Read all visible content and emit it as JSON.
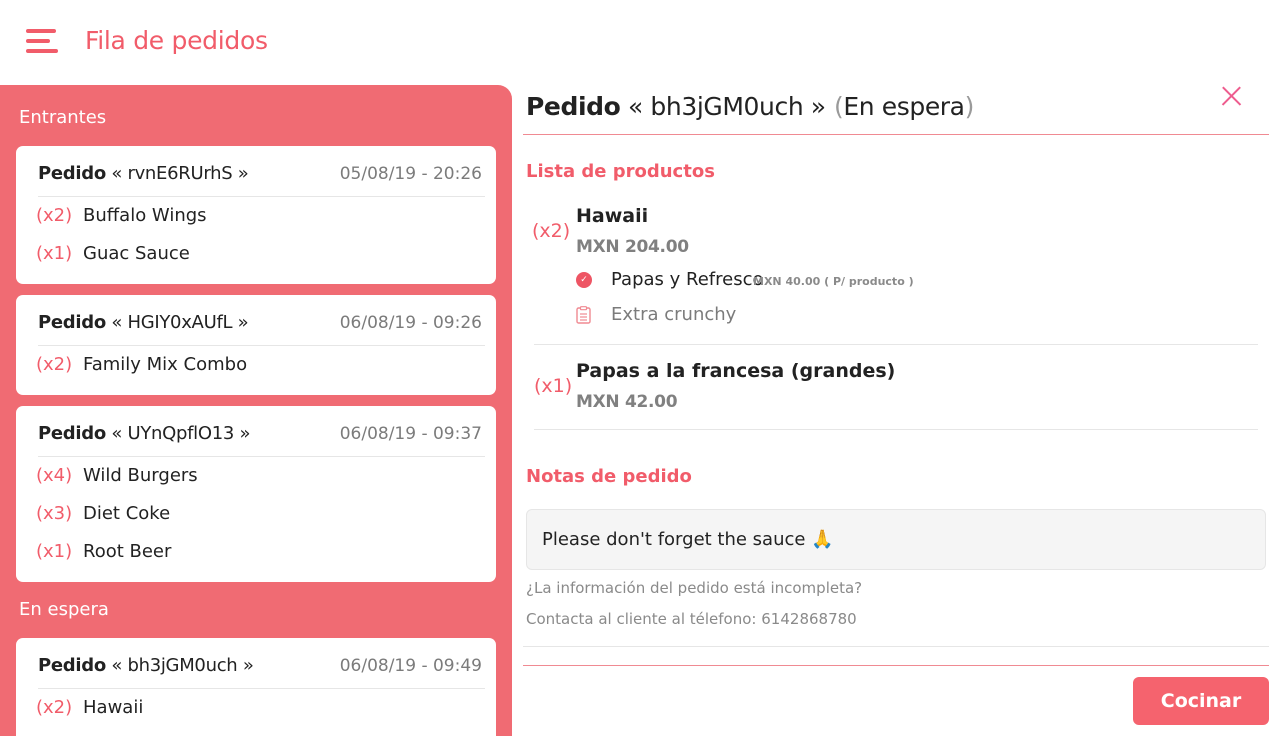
{
  "header": {
    "title": "Fila de pedidos"
  },
  "sections": {
    "incoming": "Entrantes",
    "waiting": "En espera"
  },
  "orders": [
    {
      "label": "Pedido",
      "code": "« rvnE6RUrhS »",
      "date": "05/08/19 - 20:26",
      "items": [
        {
          "qty": "(x2)",
          "name": "Buffalo Wings"
        },
        {
          "qty": "(x1)",
          "name": "Guac Sauce"
        }
      ]
    },
    {
      "label": "Pedido",
      "code": "« HGIY0xAUfL »",
      "date": "06/08/19 - 09:26",
      "items": [
        {
          "qty": "(x2)",
          "name": "Family Mix Combo"
        }
      ]
    },
    {
      "label": "Pedido",
      "code": "« UYnQpflO13 »",
      "date": "06/08/19 - 09:37",
      "items": [
        {
          "qty": "(x4)",
          "name": "Wild Burgers"
        },
        {
          "qty": "(x3)",
          "name": "Diet Coke"
        },
        {
          "qty": "(x1)",
          "name": "Root Beer"
        }
      ]
    },
    {
      "label": "Pedido",
      "code": "« bh3jGM0uch »",
      "date": "06/08/19 - 09:49",
      "items": [
        {
          "qty": "(x2)",
          "name": "Hawaii"
        }
      ]
    }
  ],
  "detail": {
    "label": "Pedido",
    "code": "« bh3jGM0uch »",
    "status_open": "(",
    "status": "En espera",
    "status_close": ")",
    "products_heading": "Lista de productos",
    "products": [
      {
        "qty": "(x2)",
        "name": "Hawaii",
        "price": "MXN 204.00",
        "modifier": {
          "name": "Papas y Refresco",
          "price": "MXN 40.00 ( P/ producto )"
        },
        "note": "Extra crunchy"
      },
      {
        "qty": "(x1)",
        "name": "Papas a la francesa (grandes)",
        "price": "MXN 42.00"
      }
    ],
    "notes_heading": "Notas de pedido",
    "notes": "Please don't forget the sauce 🙏",
    "incomplete_question": "¿La información del pedido está incompleta?",
    "contact_label": "Contacta al cliente al télefono:",
    "contact_phone": "6142868780",
    "cook_button": "Cocinar"
  },
  "colors": {
    "accent": "#f15c6a",
    "panel": "#f06b73",
    "close": "#ee5c8e"
  }
}
